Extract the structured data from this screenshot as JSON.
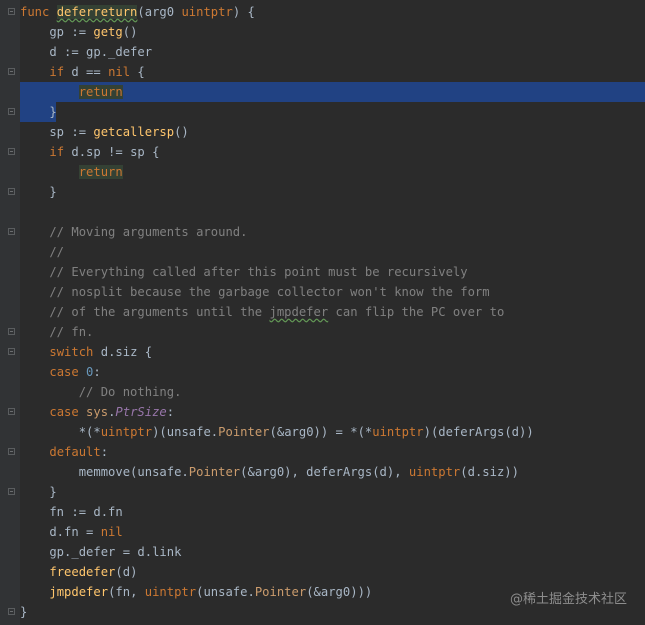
{
  "watermark": "@稀土掘金技术社区",
  "lines": [
    {
      "fold": true,
      "tokens": [
        [
          "kw",
          "func "
        ],
        [
          "fn wavy mark",
          "deferreturn"
        ],
        [
          "",
          "(arg0 "
        ],
        [
          "ty",
          "uintptr"
        ],
        [
          "",
          ") {"
        ]
      ]
    },
    {
      "tokens": [
        [
          "",
          "    gp := "
        ],
        [
          "fn",
          "getg"
        ],
        [
          "",
          "()"
        ]
      ]
    },
    {
      "tokens": [
        [
          "",
          "    d := gp._defer"
        ]
      ]
    },
    {
      "fold": true,
      "tokens": [
        [
          "",
          "    "
        ],
        [
          "kw",
          "if "
        ],
        [
          "",
          "d == "
        ],
        [
          "kw",
          "nil"
        ],
        [
          "",
          " {"
        ]
      ]
    },
    {
      "sel": "full",
      "tokens": [
        [
          "",
          "        "
        ],
        [
          "kw mark",
          "return"
        ]
      ]
    },
    {
      "fold": true,
      "sel": "part",
      "tokens": [
        [
          "",
          "    }"
        ]
      ]
    },
    {
      "tokens": [
        [
          "",
          "    sp := "
        ],
        [
          "fn",
          "getcallersp"
        ],
        [
          "",
          "()"
        ]
      ]
    },
    {
      "fold": true,
      "tokens": [
        [
          "",
          "    "
        ],
        [
          "kw",
          "if "
        ],
        [
          "",
          "d.sp != sp {"
        ]
      ]
    },
    {
      "tokens": [
        [
          "",
          "        "
        ],
        [
          "kw mark",
          "return"
        ]
      ]
    },
    {
      "fold": true,
      "tokens": [
        [
          "",
          "    }"
        ]
      ]
    },
    {
      "tokens": []
    },
    {
      "fold": true,
      "tokens": [
        [
          "cm",
          "    // Moving arguments around."
        ]
      ]
    },
    {
      "tokens": [
        [
          "cm",
          "    //"
        ]
      ]
    },
    {
      "tokens": [
        [
          "cm",
          "    // Everything called after this point must be recursively"
        ]
      ]
    },
    {
      "tokens": [
        [
          "cm",
          "    // nosplit because the garbage collector won't know the form"
        ]
      ]
    },
    {
      "tokens": [
        [
          "cm",
          "    // of the arguments until the "
        ],
        [
          "cm wavy",
          "jmpdefer"
        ],
        [
          "cm",
          " can flip the PC over to"
        ]
      ]
    },
    {
      "fold": true,
      "tokens": [
        [
          "cm",
          "    // fn."
        ]
      ]
    },
    {
      "fold": true,
      "tokens": [
        [
          "",
          "    "
        ],
        [
          "kw",
          "switch "
        ],
        [
          "",
          "d.siz {"
        ]
      ]
    },
    {
      "tokens": [
        [
          "",
          "    "
        ],
        [
          "kw",
          "case "
        ],
        [
          "num",
          "0"
        ],
        [
          "",
          ":"
        ]
      ]
    },
    {
      "tokens": [
        [
          "cm",
          "        // Do nothing."
        ]
      ]
    },
    {
      "fold": true,
      "tokens": [
        [
          "",
          "    "
        ],
        [
          "kw",
          "case "
        ],
        [
          "pkg",
          "sys"
        ],
        [
          "",
          "."
        ],
        [
          "it",
          "PtrSize"
        ],
        [
          "",
          ":"
        ]
      ]
    },
    {
      "tokens": [
        [
          "",
          "        *(*"
        ],
        [
          "ty",
          "uintptr"
        ],
        [
          "",
          ")(unsafe."
        ],
        [
          "pkg",
          "Pointer"
        ],
        [
          "",
          "(&arg0)) = *(*"
        ],
        [
          "ty",
          "uintptr"
        ],
        [
          "",
          ")(deferArgs(d))"
        ]
      ]
    },
    {
      "fold": true,
      "tokens": [
        [
          "",
          "    "
        ],
        [
          "kw",
          "default"
        ],
        [
          "",
          ":"
        ]
      ]
    },
    {
      "tokens": [
        [
          "",
          "        memmove(unsafe."
        ],
        [
          "pkg",
          "Pointer"
        ],
        [
          "",
          "(&arg0), deferArgs(d), "
        ],
        [
          "ty",
          "uintptr"
        ],
        [
          "",
          "(d.siz))"
        ]
      ]
    },
    {
      "fold": true,
      "tokens": [
        [
          "",
          "    }"
        ]
      ]
    },
    {
      "tokens": [
        [
          "",
          "    fn := d.fn"
        ]
      ]
    },
    {
      "tokens": [
        [
          "",
          "    d.fn = "
        ],
        [
          "kw",
          "nil"
        ]
      ]
    },
    {
      "tokens": [
        [
          "",
          "    gp._defer = d.link"
        ]
      ]
    },
    {
      "tokens": [
        [
          "",
          "    "
        ],
        [
          "fn",
          "freedefer"
        ],
        [
          "",
          "(d)"
        ]
      ]
    },
    {
      "tokens": [
        [
          "",
          "    "
        ],
        [
          "fn",
          "jmpdefer"
        ],
        [
          "",
          "(fn, "
        ],
        [
          "ty",
          "uintptr"
        ],
        [
          "",
          "(unsafe."
        ],
        [
          "pkg",
          "Pointer"
        ],
        [
          "",
          "(&arg0)))"
        ]
      ]
    },
    {
      "fold": true,
      "tokens": [
        [
          "",
          "}"
        ]
      ]
    }
  ]
}
